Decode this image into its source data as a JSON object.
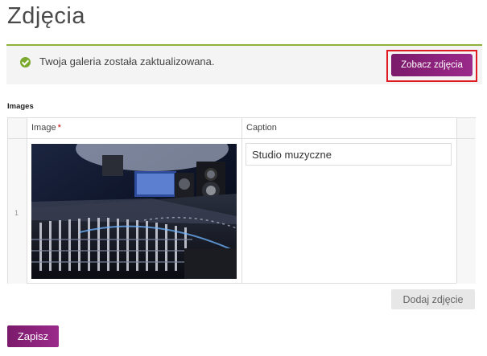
{
  "page": {
    "title": "Zdjęcia"
  },
  "notice": {
    "message": "Twoja galeria została zaktualizowana.",
    "icon": "check-circle-icon",
    "accent_color": "#8db33a",
    "view_button_label": "Zobacz zdjęcia"
  },
  "images_section": {
    "label": "Images",
    "columns": {
      "image": "Image",
      "caption": "Caption",
      "required_mark": "*"
    },
    "rows": [
      {
        "number": "1",
        "image_alt": "Studio muzyczne",
        "caption": "Studio muzyczne"
      }
    ],
    "add_button_label": "Dodaj zdjęcie"
  },
  "form": {
    "save_label": "Zapisz"
  },
  "colors": {
    "primary": "#8b2279",
    "highlight": "#e01a22"
  }
}
